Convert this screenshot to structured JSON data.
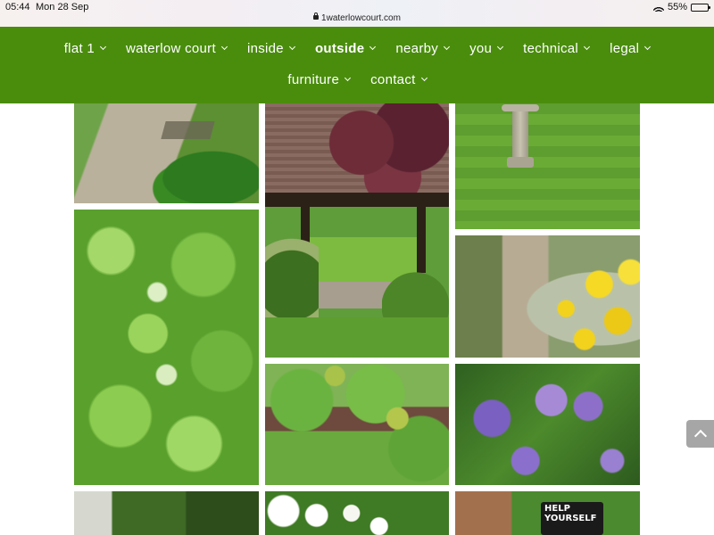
{
  "status_bar": {
    "time": "05:44",
    "date": "Mon 28 Sep",
    "url": "1waterlowcourt.com",
    "battery": "55%",
    "battery_level": 0.55
  },
  "nav": {
    "background": "#4a8d0d",
    "row1": [
      {
        "label": "flat 1"
      },
      {
        "label": "waterlow court"
      },
      {
        "label": "inside"
      },
      {
        "label": "outside",
        "active": true
      },
      {
        "label": "nearby"
      },
      {
        "label": "you"
      },
      {
        "label": "technical"
      },
      {
        "label": "legal"
      }
    ],
    "row2": [
      {
        "label": "furniture"
      },
      {
        "label": "contact"
      }
    ]
  },
  "gallery": {
    "sign_text": "HELP YOURSELF"
  },
  "icons": {
    "lock": "lock-icon",
    "wifi": "wifi-icon",
    "battery": "battery-icon",
    "chevron": "chevron-down-icon",
    "scroll_top": "chevron-up-icon"
  }
}
